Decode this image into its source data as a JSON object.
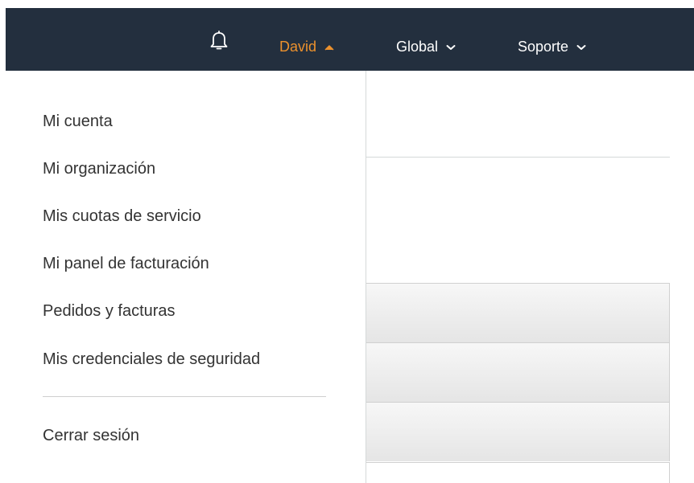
{
  "nav": {
    "bell_icon": "bell-icon",
    "user_label": "David",
    "global_label": "Global",
    "support_label": "Soporte",
    "active_color": "#ec912d",
    "bar_color": "#232f3e"
  },
  "menu": {
    "items": [
      "Mi cuenta",
      "Mi organización",
      "Mis cuotas de servicio",
      "Mi panel de facturación",
      "Pedidos y facturas",
      "Mis credenciales de seguridad"
    ],
    "logout_label": "Cerrar sesión"
  }
}
